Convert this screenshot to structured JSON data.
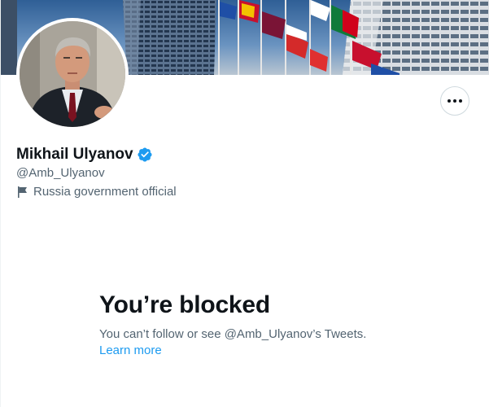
{
  "profile": {
    "display_name": "Mikhail Ulyanov",
    "handle": "@Amb_Ulyanov",
    "category": "Russia government official",
    "verified": true
  },
  "blocked": {
    "title": "You’re blocked",
    "message": "You can’t follow or see @Amb_Ulyanov’s Tweets.",
    "learn_more": "Learn more"
  },
  "icons": {
    "verified": "verified-badge-icon",
    "category": "flag-icon",
    "more": "more-horizontal-icon"
  },
  "colors": {
    "text_primary": "#0f1419",
    "text_secondary": "#536471",
    "link": "#1d9bf0",
    "verified": "#1d9bf0",
    "border": "#cfd9de"
  }
}
